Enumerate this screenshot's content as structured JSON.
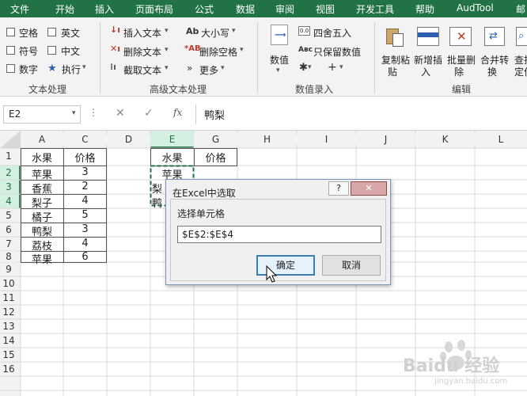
{
  "tabs": [
    "文件",
    "开始",
    "插入",
    "页面布局",
    "公式",
    "数据",
    "审阅",
    "视图",
    "开发工具",
    "帮助",
    "AudTool",
    "邮"
  ],
  "ribbon": {
    "text_group": {
      "checkboxes": [
        "空格",
        "英文",
        "符号",
        "中文",
        "数字"
      ],
      "exec": "执行",
      "label": "文本处理"
    },
    "adv_group": {
      "items": [
        "插入文本",
        "删除文本",
        "截取文本",
        "大小写",
        "删除空格",
        "更多"
      ],
      "label": "高级文本处理"
    },
    "num_group": {
      "value_btn": [
        "数值",
        "▾"
      ],
      "items": [
        "四舍五入",
        "只保留数值"
      ],
      "label": "数值录入"
    },
    "edit_group": {
      "buttons": [
        [
          "复制粘",
          "贴"
        ],
        [
          "新增插",
          "入"
        ],
        [
          "批量删",
          "除"
        ],
        [
          "合并转",
          "换"
        ],
        [
          "查找",
          "定位"
        ]
      ],
      "label": "编辑"
    }
  },
  "formula_bar": {
    "name_box": "E2",
    "fx": "fx",
    "value": "鸭梨"
  },
  "sheet": {
    "columns": [
      "A",
      "C",
      "D",
      "E",
      "G",
      "H",
      "I",
      "J",
      "K",
      "L"
    ],
    "rows": [
      "1",
      "2",
      "3",
      "4",
      "5",
      "6",
      "7",
      "8",
      "9",
      "10",
      "11",
      "12",
      "13",
      "14",
      "15",
      "16"
    ],
    "a_col": [
      "水果",
      "苹果",
      "香蕉",
      "梨子",
      "橘子",
      "鸭梨",
      "荔枝",
      "苹果"
    ],
    "c_col": [
      "价格",
      "3",
      "2",
      "4",
      "5",
      "3",
      "4",
      "6"
    ],
    "e_col": [
      "水果",
      "苹果",
      "梨",
      "鸭"
    ],
    "g_col": [
      "价格"
    ]
  },
  "dialog": {
    "title": "在Excel中选取",
    "help": "?",
    "close": "✕",
    "label": "选择单元格",
    "value": "$E$2:$E$4",
    "ok": "确定",
    "cancel": "取消"
  },
  "watermark": {
    "text": "Baidu 经验",
    "sub": "jingyan.baidu.com"
  },
  "colors": {
    "excel_green": "#217346",
    "selected_header": "#d3f0e0",
    "dialog_bg": "#f0f0f0",
    "ok_border": "#3c7fb1"
  }
}
